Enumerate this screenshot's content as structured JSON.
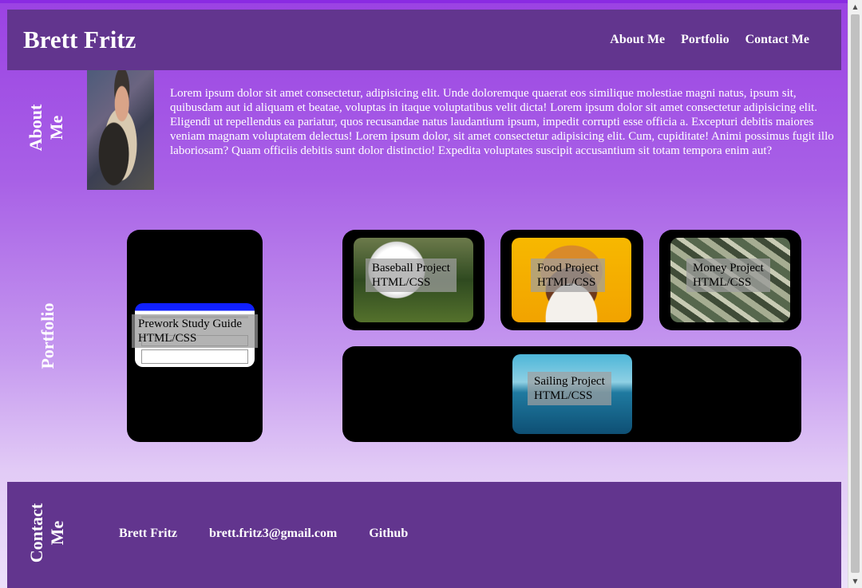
{
  "header": {
    "title": "Brett Fritz",
    "nav": [
      "About Me",
      "Portfolio",
      "Contact Me"
    ]
  },
  "about": {
    "label_line1": "About",
    "label_line2": "Me",
    "text": "Lorem ipsum dolor sit amet consectetur, adipisicing elit. Unde doloremque quaerat eos similique molestiae magni natus, ipsum sit, quibusdam aut id aliquam et beatae, voluptas in itaque voluptatibus velit dicta! Lorem ipsum dolor sit amet consectetur adipisicing elit. Eligendi ut repellendus ea pariatur, quos recusandae natus laudantium ipsum, impedit corrupti esse officia a. Excepturi debitis maiores veniam magnam voluptatem delectus! Lorem ipsum dolor, sit amet consectetur adipisicing elit. Cum, cupiditate! Animi possimus fugit illo laboriosam? Quam officiis debitis sunt dolor distinctio! Expedita voluptates suscipit accusantium sit totam tempora enim aut?"
  },
  "portfolio": {
    "label": "Portfolio",
    "projects": [
      {
        "name": "Prework Study Guide",
        "tech": "HTML/CSS"
      },
      {
        "name": "Baseball Project",
        "tech": "HTML/CSS"
      },
      {
        "name": "Food Project",
        "tech": "HTML/CSS"
      },
      {
        "name": "Money Project",
        "tech": "HTML/CSS"
      },
      {
        "name": "Sailing Project",
        "tech": "HTML/CSS"
      }
    ]
  },
  "contact": {
    "label_line1": "Contact",
    "label_line2": "Me",
    "links": [
      "Brett Fritz",
      "brett.fritz3@gmail.com",
      "Github"
    ]
  },
  "colors": {
    "header_bg": "#62358e",
    "gradient_top": "#9b43e3",
    "gradient_bottom": "#ece0fa",
    "card_bg": "#000000"
  },
  "icons": {
    "scroll_up": "scroll-up-arrow-icon",
    "scroll_down": "scroll-down-arrow-icon"
  }
}
